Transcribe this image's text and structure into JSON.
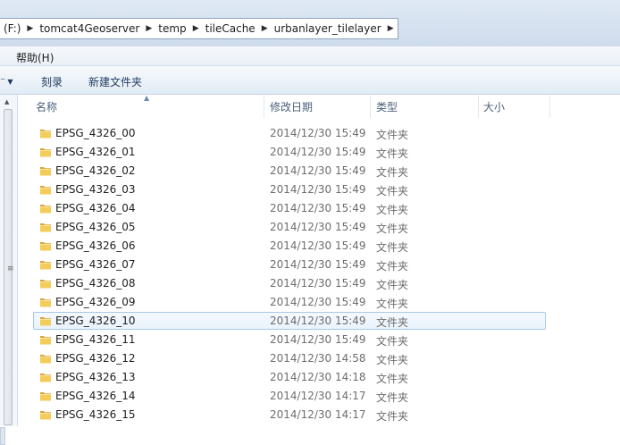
{
  "address": {
    "crumbs": [
      "(F:)",
      "tomcat4Geoserver",
      "temp",
      "tileCache",
      "urbanlayer_tilelayer"
    ]
  },
  "menu": {
    "help": "帮助(H)"
  },
  "toolbar": {
    "left_partial": "⁻",
    "burn": "刻录",
    "new_folder": "新建文件夹"
  },
  "columns": {
    "name": "名称",
    "modified": "修改日期",
    "type": "类型",
    "size": "大小"
  },
  "files": [
    {
      "name": "EPSG_4326_00",
      "date": "2014/12/30 15:49",
      "type": "文件夹"
    },
    {
      "name": "EPSG_4326_01",
      "date": "2014/12/30 15:49",
      "type": "文件夹"
    },
    {
      "name": "EPSG_4326_02",
      "date": "2014/12/30 15:49",
      "type": "文件夹"
    },
    {
      "name": "EPSG_4326_03",
      "date": "2014/12/30 15:49",
      "type": "文件夹"
    },
    {
      "name": "EPSG_4326_04",
      "date": "2014/12/30 15:49",
      "type": "文件夹"
    },
    {
      "name": "EPSG_4326_05",
      "date": "2014/12/30 15:49",
      "type": "文件夹"
    },
    {
      "name": "EPSG_4326_06",
      "date": "2014/12/30 15:49",
      "type": "文件夹"
    },
    {
      "name": "EPSG_4326_07",
      "date": "2014/12/30 15:49",
      "type": "文件夹"
    },
    {
      "name": "EPSG_4326_08",
      "date": "2014/12/30 15:49",
      "type": "文件夹"
    },
    {
      "name": "EPSG_4326_09",
      "date": "2014/12/30 15:49",
      "type": "文件夹"
    },
    {
      "name": "EPSG_4326_10",
      "date": "2014/12/30 15:49",
      "type": "文件夹",
      "selected": true
    },
    {
      "name": "EPSG_4326_11",
      "date": "2014/12/30 15:49",
      "type": "文件夹"
    },
    {
      "name": "EPSG_4326_12",
      "date": "2014/12/30 14:58",
      "type": "文件夹"
    },
    {
      "name": "EPSG_4326_13",
      "date": "2014/12/30 14:18",
      "type": "文件夹"
    },
    {
      "name": "EPSG_4326_14",
      "date": "2014/12/30 14:17",
      "type": "文件夹"
    },
    {
      "name": "EPSG_4326_15",
      "date": "2014/12/30 14:17",
      "type": "文件夹"
    }
  ],
  "icons": {
    "folder": "folder-icon",
    "separator": "breadcrumb-arrow-icon"
  },
  "colors": {
    "selection_border": "#a7c7ea",
    "folder_yellow": "#f2c94c"
  }
}
